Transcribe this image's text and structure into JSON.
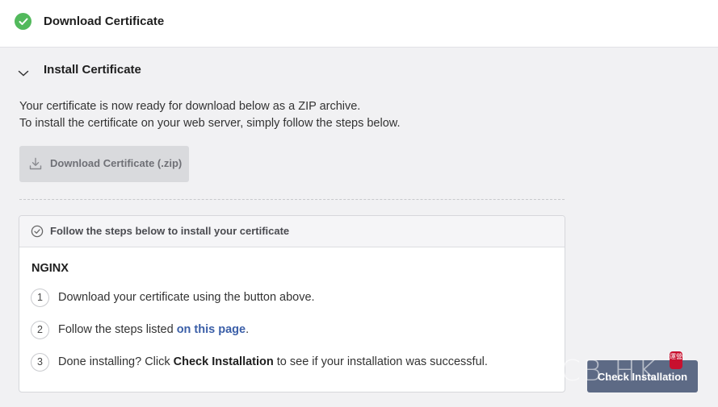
{
  "top": {
    "title": "Download Certificate"
  },
  "section": {
    "title": "Install Certificate"
  },
  "intro": {
    "line1": "Your certificate is now ready for download below as a ZIP archive.",
    "line2": "To install the certificate on your web server, simply follow the steps below."
  },
  "download_button": {
    "label": "Download Certificate (.zip)"
  },
  "card": {
    "header": "Follow the steps below to install your certificate",
    "server": "NGINX",
    "steps": [
      {
        "num": "1",
        "text": "Download your certificate using the button above."
      },
      {
        "num": "2",
        "text_before": "Follow the steps listed ",
        "link": "on this page",
        "text_after": "."
      },
      {
        "num": "3",
        "text_before": "Done installing? Click ",
        "strong": "Check Installation",
        "text_after": " to see if your installation was successful."
      }
    ]
  },
  "check_button": {
    "label": "Check Installation"
  },
  "watermark": {
    "text": "YCB.HK",
    "seal": "運營"
  },
  "colors": {
    "success": "#52b95c",
    "link": "#3b5fa8",
    "primary_button": "#5d6a85"
  },
  "icons": {
    "top_status": "check-circle-icon",
    "section_toggle": "chevron-down-icon",
    "download": "download-icon",
    "card_header": "check-outline-circle-icon"
  }
}
